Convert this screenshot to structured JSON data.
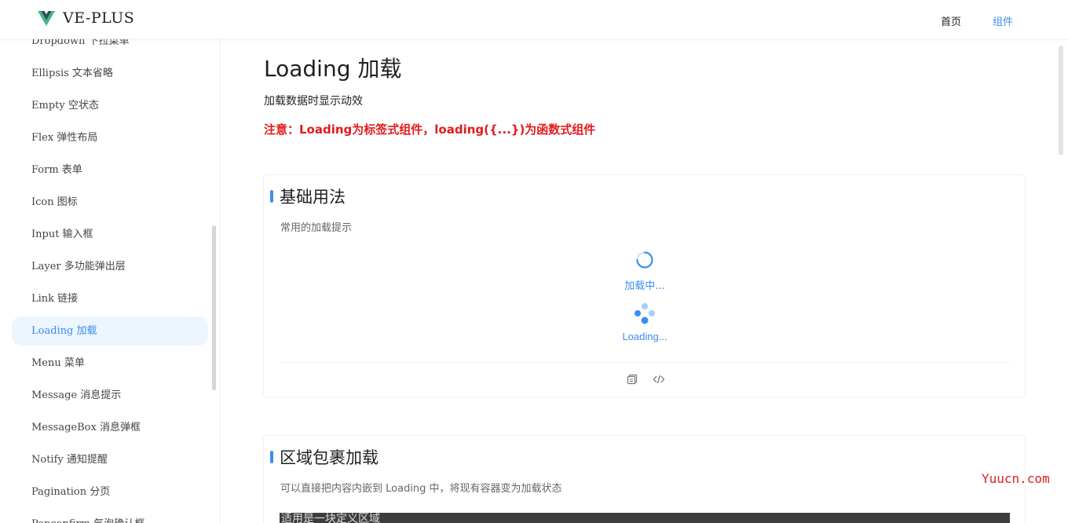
{
  "header": {
    "logo_text": "VE-PLUS",
    "nav": [
      {
        "label": "首页",
        "active": false
      },
      {
        "label": "组件",
        "active": true
      }
    ]
  },
  "sidebar": {
    "items": [
      {
        "label": "Dropdown 下拉菜单",
        "active": false
      },
      {
        "label": "Ellipsis 文本省略",
        "active": false
      },
      {
        "label": "Empty 空状态",
        "active": false
      },
      {
        "label": "Flex 弹性布局",
        "active": false
      },
      {
        "label": "Form 表单",
        "active": false
      },
      {
        "label": "Icon 图标",
        "active": false
      },
      {
        "label": "Input 输入框",
        "active": false
      },
      {
        "label": "Layer 多功能弹出层",
        "active": false
      },
      {
        "label": "Link 链接",
        "active": false
      },
      {
        "label": "Loading 加载",
        "active": true
      },
      {
        "label": "Menu 菜单",
        "active": false
      },
      {
        "label": "Message 消息提示",
        "active": false
      },
      {
        "label": "MessageBox 消息弹框",
        "active": false
      },
      {
        "label": "Notify 通知提醒",
        "active": false
      },
      {
        "label": "Pagination 分页",
        "active": false
      },
      {
        "label": "Popconfirm 气泡确认框",
        "active": false
      }
    ]
  },
  "page": {
    "title": "Loading 加载",
    "description": "加载数据时显示动效",
    "note": "注意：Loading为标签式组件，loading({...})为函数式组件"
  },
  "sections": {
    "basic": {
      "title": "基础用法",
      "description": "常用的加载提示",
      "spinner_label": "加载中...",
      "dots_label": "Loading..."
    },
    "area": {
      "title": "区域包裹加载",
      "description": "可以直接把内容内嵌到 Loading 中，将现有容器变为加载状态",
      "code_preview": "适用是一块定义区域"
    }
  },
  "icons": {
    "copy": "copy-icon",
    "code": "code-icon",
    "logo": "vue-logo-icon"
  },
  "colors": {
    "accent": "#3b8ef0",
    "warning": "#e31b1b",
    "logo_green": "#41b883",
    "logo_dark": "#35495e"
  },
  "watermark": "Yuucn.com"
}
